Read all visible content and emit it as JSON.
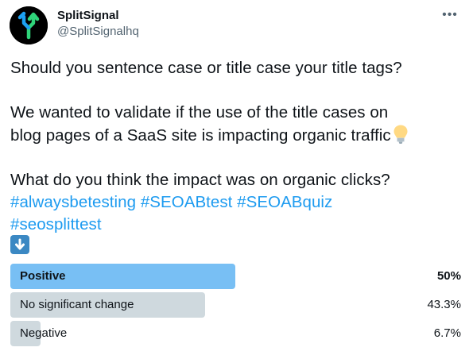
{
  "author": {
    "name": "SplitSignal",
    "handle": "@SplitSignalhq",
    "avatar_icon": "splitsignal-logo-icon"
  },
  "more_icon": "more-options-icon",
  "more_glyph": "•••",
  "tweet": {
    "line1": "Should you sentence case or title case your title tags?",
    "line2": "We wanted to validate if the use of the title cases on",
    "line3": "blog pages of a SaaS site is impacting organic traffic",
    "line3_emoji": "lightbulb-icon",
    "line4": "What do you think the impact was on organic clicks?",
    "hashtags": [
      "#alwaysbetesting",
      "#SEOABtest",
      "#SEOABquiz",
      "#seosplittest"
    ],
    "trailing_emoji": "down-arrow-icon"
  },
  "poll": {
    "options": [
      {
        "label": "Positive",
        "percent_text": "50%",
        "percent": 50,
        "winner": true,
        "color": "#78bff4"
      },
      {
        "label": "No significant change",
        "percent_text": "43.3%",
        "percent": 43.3,
        "winner": false,
        "color": "#cfd9de"
      },
      {
        "label": "Negative",
        "percent_text": "6.7%",
        "percent": 6.7,
        "winner": false,
        "color": "#cfd9de"
      }
    ]
  },
  "colors": {
    "hashtag": "#1d9bf0",
    "text": "#0f1419",
    "secondary_text": "#536471"
  }
}
